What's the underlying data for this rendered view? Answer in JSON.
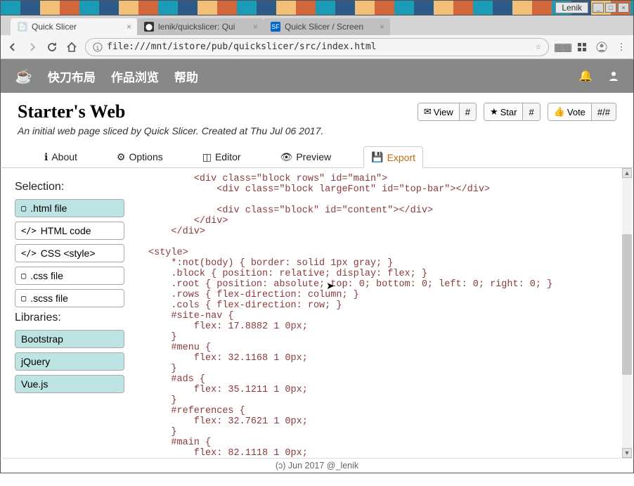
{
  "os": {
    "username": "Lenik"
  },
  "browser_tabs": [
    {
      "title": "Quick Slicer",
      "active": true,
      "favicon": "page"
    },
    {
      "title": "lenik/quickslicer: Qui",
      "active": false,
      "favicon": "github"
    },
    {
      "title": "Quick Slicer / Screen",
      "active": false,
      "favicon": "sf"
    }
  ],
  "url": "file:///mnt/istore/pub/quickslicer/src/index.html",
  "app": {
    "menu": [
      "快刀布局",
      "作品浏览",
      "帮助"
    ]
  },
  "page": {
    "title": "Starter's Web",
    "subtitle": "An initial web page sliced by Quick Slicer. Created at Thu Jul 06 2017."
  },
  "actions": {
    "view": {
      "label": "View",
      "count": "#"
    },
    "star": {
      "label": "Star",
      "count": "#"
    },
    "vote": {
      "label": "Vote",
      "count": "#/#"
    }
  },
  "tabs": [
    {
      "icon": "info",
      "label": "About"
    },
    {
      "icon": "gear",
      "label": "Options"
    },
    {
      "icon": "crop",
      "label": "Editor"
    },
    {
      "icon": "eye",
      "label": "Preview"
    },
    {
      "icon": "save",
      "label": "Export",
      "active": true
    }
  ],
  "sidebar": {
    "selection_label": "Selection:",
    "selection": [
      {
        "label": ".html file",
        "icon": "html5",
        "selected": true
      },
      {
        "label": "HTML code",
        "icon": "code"
      },
      {
        "label": "CSS <style>",
        "icon": "code"
      },
      {
        "label": ".css file",
        "icon": "css3"
      },
      {
        "label": ".scss file",
        "icon": "css3"
      }
    ],
    "libraries_label": "Libraries:",
    "libraries": [
      {
        "label": "Bootstrap",
        "selected": true
      },
      {
        "label": "jQuery",
        "selected": true
      },
      {
        "label": "Vue.js",
        "selected": true
      }
    ]
  },
  "code": "        <div class=\"block rows\" id=\"main\">\n            <div class=\"block largeFont\" id=\"top-bar\"></div>\n\n            <div class=\"block\" id=\"content\"></div>\n        </div>\n    </div>\n\n<style>\n    *:not(body) { border: solid 1px gray; }\n    .block { position: relative; display: flex; }\n    .root { position: absolute; top: 0; bottom: 0; left: 0; right: 0; }\n    .rows { flex-direction: column; }\n    .cols { flex-direction: row; }\n    #site-nav {\n        flex: 17.8882 1 0px;\n    }\n    #menu {\n        flex: 32.1168 1 0px;\n    }\n    #ads {\n        flex: 35.1211 1 0px;\n    }\n    #references {\n        flex: 32.7621 1 0px;\n    }\n    #main {\n        flex: 82.1118 1 0px;",
  "footer": "(ɔ) Jun 2017 @_lenik"
}
